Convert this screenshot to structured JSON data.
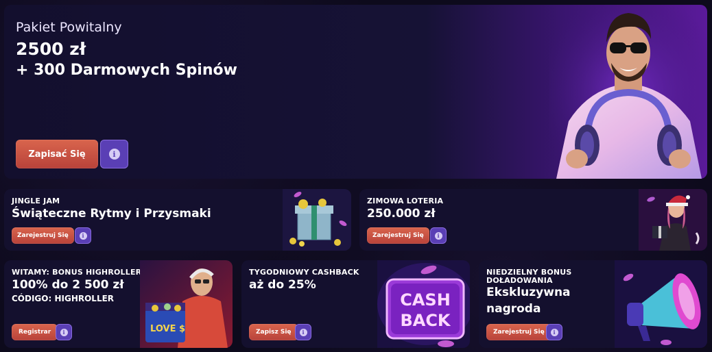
{
  "hero": {
    "subtitle": "Pakiet Powitalny",
    "amount": "2500 zł",
    "spins": "+ 300 Darmowych Spinów",
    "cta_label": "Zapisać Się",
    "info_icon": "info-icon"
  },
  "promos_row1": [
    {
      "tag": "JINGLE JAM",
      "headline": "Świąteczne Rytmy i Przysmaki",
      "cta_label": "Zarejestruj Się",
      "art": "gift-box-with-coins"
    },
    {
      "tag": "ZIMOWA LOTERIA",
      "headline": "250.000 zł",
      "cta_label": "Zarejestruj Się",
      "art": "santa-girl-with-gift"
    }
  ],
  "promos_row2": [
    {
      "tag": "WITAMY: BONUS HIGHROLLER",
      "line1": "100% do 2 500 zł",
      "line2": "CÓDIGO: HIGHROLLER",
      "cta_label": "Registrar",
      "art_text": "LOVE $"
    },
    {
      "tag": "TYGODNIOWY CASHBACK",
      "line1": "aż do 25%",
      "cta_label": "Zapisz Się",
      "art_text1": "CASH",
      "art_text2": "BACK"
    },
    {
      "tag1": "NIEDZIELNY BONUS",
      "tag2": "DOŁADOWANIA",
      "line1": "Ekskluzywna",
      "line2": "nagroda",
      "cta_label": "Zarejestruj Się",
      "art": "megaphone"
    }
  ],
  "colors": {
    "background": "#0d0a1c",
    "card": "#14102e",
    "cta": "#c9503f",
    "info": "#5a3fb5"
  }
}
